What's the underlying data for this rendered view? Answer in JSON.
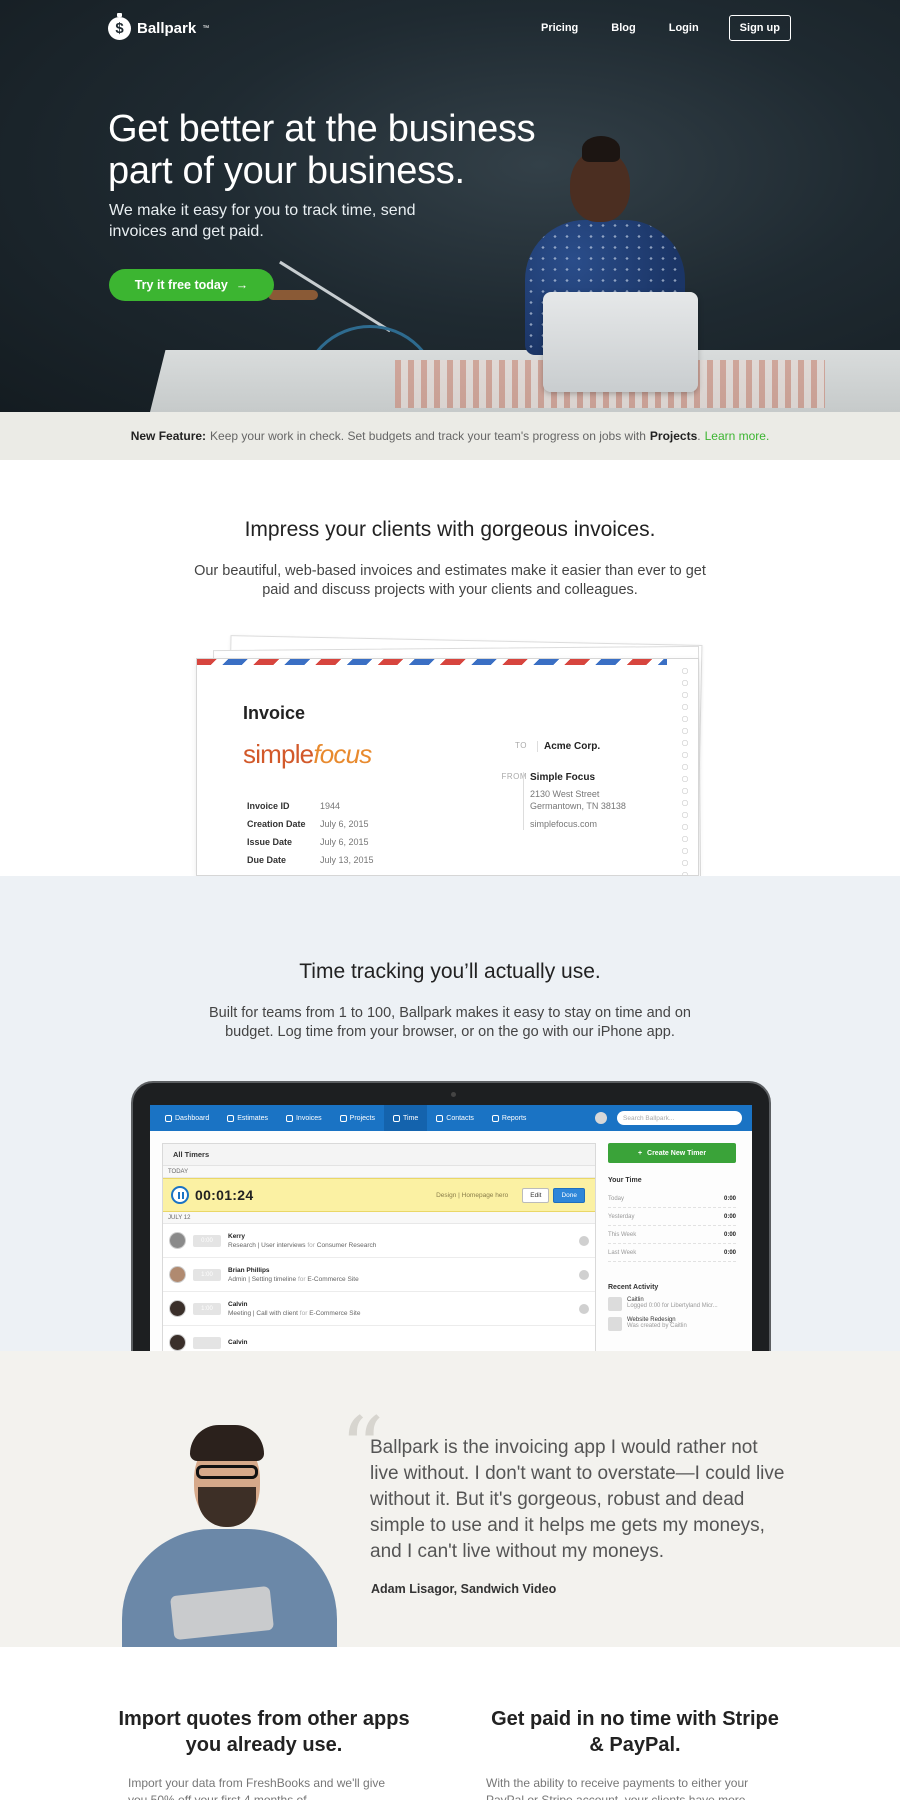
{
  "brand": {
    "name": "Ballpark",
    "tm": "™"
  },
  "nav": {
    "pricing": "Pricing",
    "blog": "Blog",
    "login": "Login",
    "signup": "Sign up"
  },
  "hero": {
    "title": "Get better at the business part of your business.",
    "subtitle": "We make it easy for you to track time, send invoices and get paid.",
    "cta": "Try it free today",
    "cta_arrow": "→"
  },
  "banner": {
    "label": "New Feature:",
    "text": "Keep your work in check. Set budgets and track your team's progress on jobs with",
    "projects": "Projects",
    "period": ".",
    "link": "Learn more."
  },
  "invoices": {
    "title": "Impress your clients with gorgeous invoices.",
    "body": "Our beautiful, web-based invoices and estimates make it easier than ever to get paid and discuss projects with your clients and colleagues.",
    "card": {
      "heading": "Invoice",
      "logo_a": "simple",
      "logo_b": "focus",
      "meta": [
        {
          "k": "Invoice ID",
          "v": "1944"
        },
        {
          "k": "Creation Date",
          "v": "July 6, 2015"
        },
        {
          "k": "Issue Date",
          "v": "July 6, 2015"
        },
        {
          "k": "Due Date",
          "v": "July 13, 2015"
        }
      ],
      "to_label": "TO",
      "to_value": "Acme Corp.",
      "from_label": "FROM",
      "from_name": "Simple Focus",
      "from_addr1": "2130 West Street",
      "from_addr2": "Germantown, TN 38138",
      "from_url": "simplefocus.com"
    }
  },
  "time": {
    "title": "Time tracking you’ll actually use.",
    "body": "Built for teams from 1 to 100, Ballpark makes it easy to stay on time and on budget. Log time from your browser, or on the go with our iPhone app.",
    "app": {
      "nav": [
        "Dashboard",
        "Estimates",
        "Invoices",
        "Projects",
        "Time",
        "Contacts",
        "Reports"
      ],
      "search_placeholder": "Search Ballpark...",
      "timers_header": "All Timers",
      "today": "TODAY",
      "running_time": "00:01:24",
      "running_task": "Design | Homepage hero",
      "edit": "Edit",
      "done": "Done",
      "date2": "JULY 12",
      "entries": [
        {
          "name": "Kerry",
          "hrs": "0:00",
          "desc": "Research | User interviews",
          "for": "for",
          "client": "Consumer Research"
        },
        {
          "name": "Brian Phillips",
          "hrs": "1:00",
          "desc": "Admin | Setting timeline",
          "for": "for",
          "client": "E-Commerce Site"
        },
        {
          "name": "Calvin",
          "hrs": "1:00",
          "desc": "Meeting | Call with client",
          "for": "for",
          "client": "E-Commerce Site"
        },
        {
          "name": "Calvin",
          "hrs": "",
          "desc": "",
          "for": "",
          "client": ""
        }
      ],
      "new_timer": "Create New Timer",
      "your_time": "Your Time",
      "your_time_rows": [
        {
          "k": "Today",
          "v": "0:00"
        },
        {
          "k": "Yesterday",
          "v": "0:00"
        },
        {
          "k": "This Week",
          "v": "0:00"
        },
        {
          "k": "Last Week",
          "v": "0:00"
        }
      ],
      "recent_activity": "Recent Activity",
      "activity": [
        {
          "who": "Caitlin",
          "what": "Logged 0:00 for Libertyland Micr..."
        },
        {
          "who": "Website Redesign",
          "what": "Was created by Caitlin"
        }
      ]
    }
  },
  "testimonial": {
    "quote_mark": "“",
    "quote": "Ballpark is the invoicing app I would rather not live without. I don't want to overstate—I could live without it. But it's gorgeous, robust and dead simple to use and it helps me gets my moneys, and I can't live without my moneys.",
    "author": "Adam Lisagor, Sandwich Video"
  },
  "features": [
    {
      "title": "Import quotes from other apps you already use.",
      "body": "Import your data from FreshBooks and we'll give you 50% off your first 4 months of"
    },
    {
      "title": "Get paid in no time with Stripe & PayPal.",
      "body": "With the ability to receive payments to either your PayPal or Stripe account, your clients have more"
    }
  ],
  "colors": {
    "accent_green": "#3cb531",
    "app_blue": "#1a73c4",
    "hero_bg": "#1f2a31"
  }
}
